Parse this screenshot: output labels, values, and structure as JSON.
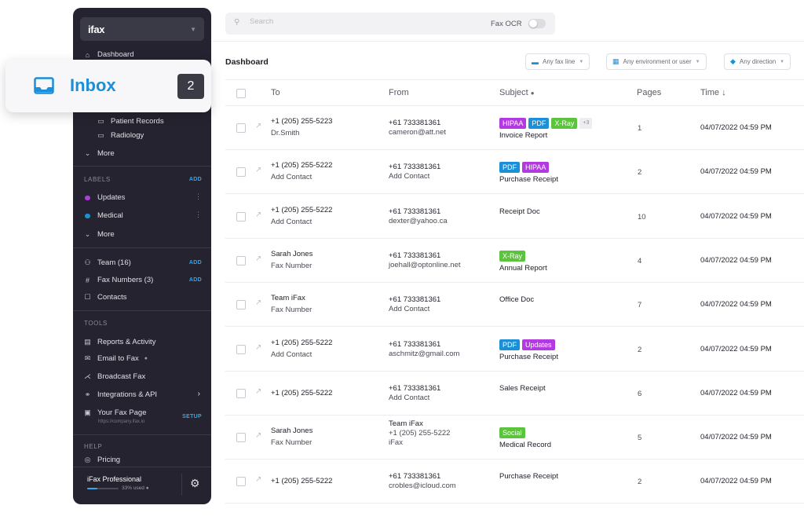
{
  "app": {
    "logo": "ifax"
  },
  "sidebar": {
    "dashboard_label": "Dashboard",
    "folders": [
      "Patient Records",
      "Radiology"
    ],
    "folders_more": "More",
    "labels_head": "LABELS",
    "labels_add": "ADD",
    "labels": [
      {
        "name": "Updates",
        "color": "#b13be0"
      },
      {
        "name": "Medical",
        "color": "#1c8fd6"
      }
    ],
    "labels_more": "More",
    "team_label": "Team (16)",
    "team_add": "ADD",
    "fax_numbers_label": "Fax Numbers (3)",
    "fax_numbers_add": "ADD",
    "contacts_label": "Contacts",
    "tools_head": "TOOLS",
    "tools": {
      "reports": "Reports & Activity",
      "email_to_fax": "Email to Fax",
      "broadcast": "Broadcast Fax",
      "integrations": "Integrations & API",
      "fax_page": "Your Fax Page",
      "fax_page_url": "https://company.ifax.io",
      "fax_page_action": "SETUP"
    },
    "help_head": "HELP",
    "pricing_label": "Pricing",
    "plan": {
      "name": "iFax Professional",
      "used_text": "33% used",
      "used_fraction": 0.33
    }
  },
  "inbox": {
    "label": "Inbox",
    "count": "2"
  },
  "search": {
    "placeholder": "Search",
    "value": ""
  },
  "fax_ocr": {
    "label": "Fax OCR",
    "enabled": false
  },
  "main": {
    "title": "Dashboard",
    "filters": [
      "Any fax line",
      "Any environment or user",
      "Any direction"
    ]
  },
  "table": {
    "headers": {
      "to": "To",
      "from": "From",
      "subject": "Subject",
      "pages": "Pages",
      "time": "Time ↓"
    },
    "rows": [
      {
        "to1": "+1 (205) 255-5223",
        "to2": "Dr.Smith",
        "from1": "+61 733381361",
        "from2": "cameron@att.net",
        "from3": "",
        "tags": [
          {
            "t": "HIPAA",
            "c": "#b13be0"
          },
          {
            "t": "PDF",
            "c": "#1c8fd6"
          },
          {
            "t": "X-Ray",
            "c": "#5cc33c"
          }
        ],
        "more": "+3",
        "subject": "Invoice Report",
        "pages": "1",
        "time": "04/07/2022 04:59 PM"
      },
      {
        "to1": "+1 (205) 255-5222",
        "to2": "Add Contact",
        "from1": "+61 733381361",
        "from2": "Add Contact",
        "from3": "",
        "tags": [
          {
            "t": "PDF",
            "c": "#1c8fd6"
          },
          {
            "t": "HIPAA",
            "c": "#b13be0"
          }
        ],
        "more": "",
        "subject": "Purchase Receipt",
        "pages": "2",
        "time": "04/07/2022 04:59 PM"
      },
      {
        "to1": "+1 (205) 255-5222",
        "to2": "Add Contact",
        "from1": "+61 733381361",
        "from2": "dexter@yahoo.ca",
        "from3": "",
        "tags": [],
        "more": "",
        "subject": "Receipt Doc",
        "pages": "10",
        "time": "04/07/2022 04:59 PM"
      },
      {
        "to1": "Sarah Jones",
        "to2": "Fax Number",
        "from1": "+61 733381361",
        "from2": "joehall@optonline.net",
        "from3": "",
        "tags": [
          {
            "t": "X-Ray",
            "c": "#5cc33c"
          }
        ],
        "more": "",
        "subject": "Annual Report",
        "pages": "4",
        "time": "04/07/2022 04:59 PM"
      },
      {
        "to1": "Team iFax",
        "to2": "Fax Number",
        "from1": "+61 733381361",
        "from2": "Add Contact",
        "from3": "",
        "tags": [],
        "more": "",
        "subject": "Office Doc",
        "pages": "7",
        "time": "04/07/2022 04:59 PM"
      },
      {
        "to1": "+1 (205) 255-5222",
        "to2": "Add Contact",
        "from1": "+61 733381361",
        "from2": "aschmitz@gmail.com",
        "from3": "",
        "tags": [
          {
            "t": "PDF",
            "c": "#1c8fd6"
          },
          {
            "t": "Updates",
            "c": "#b13be0"
          }
        ],
        "more": "",
        "subject": "Purchase Receipt",
        "pages": "2",
        "time": "04/07/2022 04:59 PM"
      },
      {
        "to1": "+1 (205) 255-5222",
        "to2": "",
        "from1": "+61 733381361",
        "from2": "Add Contact",
        "from3": "",
        "tags": [],
        "more": "",
        "subject": "Sales Receipt",
        "pages": "6",
        "time": "04/07/2022 04:59 PM"
      },
      {
        "to1": "Sarah Jones",
        "to2": "Fax Number",
        "from1": "Team iFax",
        "from2": "+1 (205) 255-5222",
        "from3": "iFax",
        "tags": [
          {
            "t": "Social",
            "c": "#5cc33c"
          }
        ],
        "more": "",
        "subject": "Medical Record",
        "pages": "5",
        "time": "04/07/2022 04:59 PM"
      },
      {
        "to1": "+1 (205) 255-5222",
        "to2": "",
        "from1": "+61 733381361",
        "from2": "crobles@icloud.com",
        "from3": "",
        "tags": [],
        "more": "",
        "subject": "Purchase Receipt",
        "pages": "2",
        "time": "04/07/2022 04:59 PM"
      }
    ]
  }
}
